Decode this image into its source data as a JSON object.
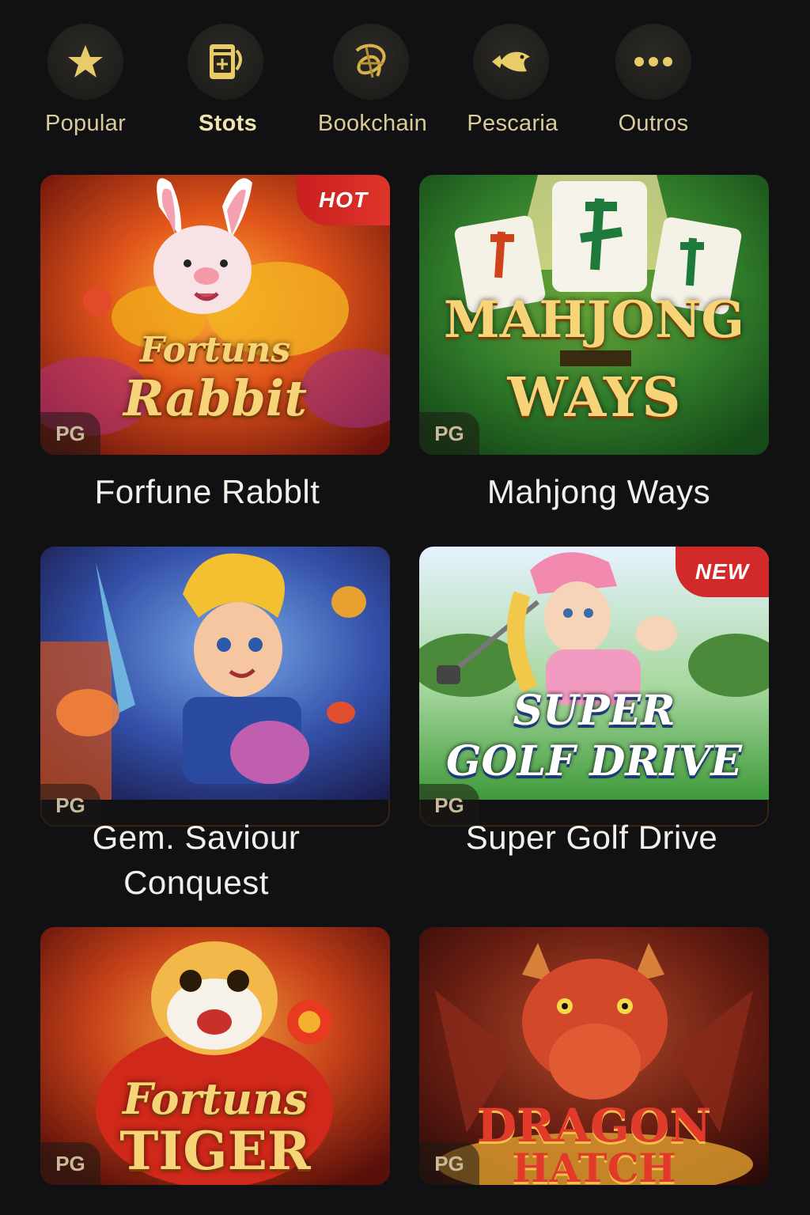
{
  "categories": [
    {
      "label": "Popular",
      "icon": "star-icon",
      "active": false
    },
    {
      "label": "Stots",
      "icon": "slot-machine-icon",
      "active": true
    },
    {
      "label": "Bookchain",
      "icon": "bookchain-icon",
      "active": false
    },
    {
      "label": "Pescaria",
      "icon": "fish-icon",
      "active": false
    },
    {
      "label": "Outros",
      "icon": "more-icon",
      "active": false
    }
  ],
  "games": [
    {
      "title": "Forfune Rabblt",
      "art_line1": "Fortuns",
      "art_line2": "Rabbit",
      "provider": "PG",
      "badge": "HOT"
    },
    {
      "title": "Mahjong Ways",
      "art_line1": "MAHJONG",
      "art_line2": "WAYS",
      "provider": "PG",
      "badge": ""
    },
    {
      "title": "Gem. Saviour Conquest",
      "provider": "PG",
      "badge": ""
    },
    {
      "title": "Super Golf Drive",
      "art_line1": "SUPER",
      "art_line2": "GOLF DRIVE",
      "provider": "PG",
      "badge": "NEW"
    },
    {
      "title": "",
      "art_line1": "Fortuns",
      "art_line2": "TIGER",
      "provider": "PG",
      "badge": ""
    },
    {
      "title": "",
      "art_line1": "DRAGON",
      "art_line2": "HATCH",
      "provider": "PG",
      "badge": ""
    }
  ],
  "colors": {
    "background": "#111113",
    "accent_gold": "#d9cc9a",
    "badge_red": "#d22a2a"
  }
}
